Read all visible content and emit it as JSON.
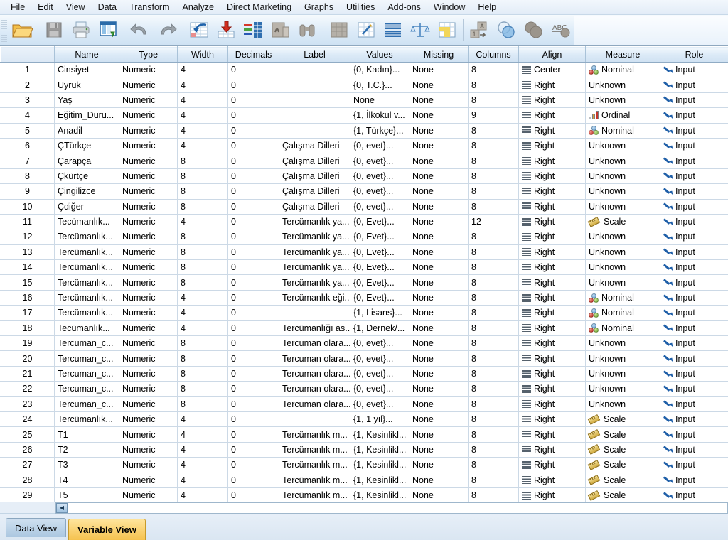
{
  "menu": {
    "items": [
      {
        "label": "File",
        "accel": "F"
      },
      {
        "label": "Edit",
        "accel": "E"
      },
      {
        "label": "View",
        "accel": "V"
      },
      {
        "label": "Data",
        "accel": "D"
      },
      {
        "label": "Transform",
        "accel": "T"
      },
      {
        "label": "Analyze",
        "accel": "A"
      },
      {
        "label": "Direct Marketing",
        "accel": "M"
      },
      {
        "label": "Graphs",
        "accel": "G"
      },
      {
        "label": "Utilities",
        "accel": "U"
      },
      {
        "label": "Add-ons",
        "accel": "o"
      },
      {
        "label": "Window",
        "accel": "W"
      },
      {
        "label": "Help",
        "accel": "H"
      }
    ]
  },
  "toolbar": {
    "buttons": [
      {
        "name": "open-file-icon",
        "title": "Open data document"
      },
      {
        "name": "save-icon",
        "title": "Save this document"
      },
      {
        "name": "print-icon",
        "title": "Print"
      },
      {
        "name": "recall-dialogs-icon",
        "title": "Recall recently used dialogs"
      },
      {
        "name": "undo-icon",
        "title": "Undo"
      },
      {
        "name": "redo-icon",
        "title": "Redo"
      },
      {
        "name": "goto-case-icon",
        "title": "Go to case"
      },
      {
        "name": "goto-variable-icon",
        "title": "Go to variable"
      },
      {
        "name": "variables-icon",
        "title": "Variables"
      },
      {
        "name": "run-descriptives-icon",
        "title": "Run descriptive statistics"
      },
      {
        "name": "find-icon",
        "title": "Find"
      },
      {
        "name": "insert-case-icon",
        "title": "Insert case"
      },
      {
        "name": "insert-variable-icon",
        "title": "Insert variable"
      },
      {
        "name": "split-file-icon",
        "title": "Split file"
      },
      {
        "name": "weight-cases-icon",
        "title": "Weight cases"
      },
      {
        "name": "select-cases-icon",
        "title": "Select cases"
      },
      {
        "name": "value-labels-icon",
        "title": "Value labels"
      },
      {
        "name": "use-variable-sets-icon",
        "title": "Use variable sets"
      },
      {
        "name": "show-all-variables-icon",
        "title": "Show all variables"
      },
      {
        "name": "spell-check-icon",
        "title": "Spell check"
      }
    ]
  },
  "grid": {
    "columns": [
      "Name",
      "Type",
      "Width",
      "Decimals",
      "Label",
      "Values",
      "Missing",
      "Columns",
      "Align",
      "Measure",
      "Role"
    ],
    "rows": [
      {
        "n": "1",
        "name": "Cinsiyet",
        "type": "Numeric",
        "width": "4",
        "decimals": "0",
        "label": "",
        "values": "{0, Kadın}...",
        "missing": "None",
        "columns": "8",
        "align": "Center",
        "measure": "Nominal",
        "role": "Input"
      },
      {
        "n": "2",
        "name": "Uyruk",
        "type": "Numeric",
        "width": "4",
        "decimals": "0",
        "label": "",
        "values": "{0, T.C.}...",
        "missing": "None",
        "columns": "8",
        "align": "Right",
        "measure": "Unknown",
        "role": "Input"
      },
      {
        "n": "3",
        "name": "Yaş",
        "type": "Numeric",
        "width": "4",
        "decimals": "0",
        "label": "",
        "values": "None",
        "missing": "None",
        "columns": "8",
        "align": "Right",
        "measure": "Unknown",
        "role": "Input"
      },
      {
        "n": "4",
        "name": "Eğitim_Duru...",
        "type": "Numeric",
        "width": "4",
        "decimals": "0",
        "label": "",
        "values": "{1, İlkokul v...",
        "missing": "None",
        "columns": "9",
        "align": "Right",
        "measure": "Ordinal",
        "role": "Input"
      },
      {
        "n": "5",
        "name": "Anadil",
        "type": "Numeric",
        "width": "4",
        "decimals": "0",
        "label": "",
        "values": "{1, Türkçe}...",
        "missing": "None",
        "columns": "8",
        "align": "Right",
        "measure": "Nominal",
        "role": "Input"
      },
      {
        "n": "6",
        "name": "ÇTürkçe",
        "type": "Numeric",
        "width": "4",
        "decimals": "0",
        "label": "Çalışma Dilleri",
        "values": "{0, evet}...",
        "missing": "None",
        "columns": "8",
        "align": "Right",
        "measure": "Unknown",
        "role": "Input"
      },
      {
        "n": "7",
        "name": "Çarapça",
        "type": "Numeric",
        "width": "8",
        "decimals": "0",
        "label": "Çalışma Dilleri",
        "values": "{0, evet}...",
        "missing": "None",
        "columns": "8",
        "align": "Right",
        "measure": "Unknown",
        "role": "Input"
      },
      {
        "n": "8",
        "name": "Çkürtçe",
        "type": "Numeric",
        "width": "8",
        "decimals": "0",
        "label": "Çalışma Dilleri",
        "values": "{0, evet}...",
        "missing": "None",
        "columns": "8",
        "align": "Right",
        "measure": "Unknown",
        "role": "Input"
      },
      {
        "n": "9",
        "name": "Çingilizce",
        "type": "Numeric",
        "width": "8",
        "decimals": "0",
        "label": "Çalışma Dilleri",
        "values": "{0, evet}...",
        "missing": "None",
        "columns": "8",
        "align": "Right",
        "measure": "Unknown",
        "role": "Input"
      },
      {
        "n": "10",
        "name": "Çdiğer",
        "type": "Numeric",
        "width": "8",
        "decimals": "0",
        "label": "Çalışma Dilleri",
        "values": "{0, evet}...",
        "missing": "None",
        "columns": "8",
        "align": "Right",
        "measure": "Unknown",
        "role": "Input"
      },
      {
        "n": "11",
        "name": "Tecümanlık...",
        "type": "Numeric",
        "width": "4",
        "decimals": "0",
        "label": "Tercümanlık ya...",
        "values": "{0, Evet}...",
        "missing": "None",
        "columns": "12",
        "align": "Right",
        "measure": "Scale",
        "role": "Input"
      },
      {
        "n": "12",
        "name": "Tercümanlık...",
        "type": "Numeric",
        "width": "8",
        "decimals": "0",
        "label": "Tercümanlık ya...",
        "values": "{0, Evet}...",
        "missing": "None",
        "columns": "8",
        "align": "Right",
        "measure": "Unknown",
        "role": "Input"
      },
      {
        "n": "13",
        "name": "Tercümanlık...",
        "type": "Numeric",
        "width": "8",
        "decimals": "0",
        "label": "Tercümanlık ya...",
        "values": "{0, Evet}...",
        "missing": "None",
        "columns": "8",
        "align": "Right",
        "measure": "Unknown",
        "role": "Input"
      },
      {
        "n": "14",
        "name": "Tercümanlık...",
        "type": "Numeric",
        "width": "8",
        "decimals": "0",
        "label": "Tercümanlık ya...",
        "values": "{0, Evet}...",
        "missing": "None",
        "columns": "8",
        "align": "Right",
        "measure": "Unknown",
        "role": "Input"
      },
      {
        "n": "15",
        "name": "Tercümanlık...",
        "type": "Numeric",
        "width": "8",
        "decimals": "0",
        "label": "Tercümanlık ya...",
        "values": "{0, Evet}...",
        "missing": "None",
        "columns": "8",
        "align": "Right",
        "measure": "Unknown",
        "role": "Input"
      },
      {
        "n": "16",
        "name": "Tercümanlık...",
        "type": "Numeric",
        "width": "4",
        "decimals": "0",
        "label": "Tercümanlık eği...",
        "values": "{0, Evet}...",
        "missing": "None",
        "columns": "8",
        "align": "Right",
        "measure": "Nominal",
        "role": "Input"
      },
      {
        "n": "17",
        "name": "Tercümanlık...",
        "type": "Numeric",
        "width": "4",
        "decimals": "0",
        "label": "",
        "values": "{1, Lisans}...",
        "missing": "None",
        "columns": "8",
        "align": "Right",
        "measure": "Nominal",
        "role": "Input"
      },
      {
        "n": "18",
        "name": "Tecümanlık...",
        "type": "Numeric",
        "width": "4",
        "decimals": "0",
        "label": "Tercümanlığı as...",
        "values": "{1, Dernek/...",
        "missing": "None",
        "columns": "8",
        "align": "Right",
        "measure": "Nominal",
        "role": "Input"
      },
      {
        "n": "19",
        "name": "Tercuman_c...",
        "type": "Numeric",
        "width": "8",
        "decimals": "0",
        "label": "Tercuman olara...",
        "values": "{0, evet}...",
        "missing": "None",
        "columns": "8",
        "align": "Right",
        "measure": "Unknown",
        "role": "Input"
      },
      {
        "n": "20",
        "name": "Tercuman_c...",
        "type": "Numeric",
        "width": "8",
        "decimals": "0",
        "label": "Tercuman olara...",
        "values": "{0, evet}...",
        "missing": "None",
        "columns": "8",
        "align": "Right",
        "measure": "Unknown",
        "role": "Input"
      },
      {
        "n": "21",
        "name": "Tercuman_c...",
        "type": "Numeric",
        "width": "8",
        "decimals": "0",
        "label": "Tercuman olara...",
        "values": "{0, evet}...",
        "missing": "None",
        "columns": "8",
        "align": "Right",
        "measure": "Unknown",
        "role": "Input"
      },
      {
        "n": "22",
        "name": "Tercuman_c...",
        "type": "Numeric",
        "width": "8",
        "decimals": "0",
        "label": "Tercuman olara...",
        "values": "{0, evet}...",
        "missing": "None",
        "columns": "8",
        "align": "Right",
        "measure": "Unknown",
        "role": "Input"
      },
      {
        "n": "23",
        "name": "Tercuman_c...",
        "type": "Numeric",
        "width": "8",
        "decimals": "0",
        "label": "Tercuman olara...",
        "values": "{0, evet}...",
        "missing": "None",
        "columns": "8",
        "align": "Right",
        "measure": "Unknown",
        "role": "Input"
      },
      {
        "n": "24",
        "name": "Tercümanlık...",
        "type": "Numeric",
        "width": "4",
        "decimals": "0",
        "label": "",
        "values": "{1, 1 yıl}...",
        "missing": "None",
        "columns": "8",
        "align": "Right",
        "measure": "Scale",
        "role": "Input"
      },
      {
        "n": "25",
        "name": "T1",
        "type": "Numeric",
        "width": "4",
        "decimals": "0",
        "label": "Tercümanlık m...",
        "values": "{1, Kesinlikl...",
        "missing": "None",
        "columns": "8",
        "align": "Right",
        "measure": "Scale",
        "role": "Input"
      },
      {
        "n": "26",
        "name": "T2",
        "type": "Numeric",
        "width": "4",
        "decimals": "0",
        "label": "Tercümanlık m...",
        "values": "{1, Kesinlikl...",
        "missing": "None",
        "columns": "8",
        "align": "Right",
        "measure": "Scale",
        "role": "Input"
      },
      {
        "n": "27",
        "name": "T3",
        "type": "Numeric",
        "width": "4",
        "decimals": "0",
        "label": "Tercümanlık m...",
        "values": "{1, Kesinlikl...",
        "missing": "None",
        "columns": "8",
        "align": "Right",
        "measure": "Scale",
        "role": "Input"
      },
      {
        "n": "28",
        "name": "T4",
        "type": "Numeric",
        "width": "4",
        "decimals": "0",
        "label": "Tercümanlık m...",
        "values": "{1, Kesinlikl...",
        "missing": "None",
        "columns": "8",
        "align": "Right",
        "measure": "Scale",
        "role": "Input"
      },
      {
        "n": "29",
        "name": "T5",
        "type": "Numeric",
        "width": "4",
        "decimals": "0",
        "label": "Tercümanlık m...",
        "values": "{1, Kesinlikl...",
        "missing": "None",
        "columns": "8",
        "align": "Right",
        "measure": "Scale",
        "role": "Input"
      }
    ]
  },
  "scrollbar": {
    "left_arrow": "◀"
  },
  "tabs": [
    {
      "label": "Data View",
      "active": false
    },
    {
      "label": "Variable View",
      "active": true
    }
  ],
  "colors": {
    "header_blue": "#dceaf7",
    "rownum_blue": "#cfe0f1",
    "active_tab": "#f5c24f",
    "inactive_tab": "#abc7e0",
    "nominal_red": "#c32a1d",
    "ordinal_gold": "#d9a23a",
    "scale_gold": "#cfa93e",
    "input_blue": "#1f5fa8"
  }
}
